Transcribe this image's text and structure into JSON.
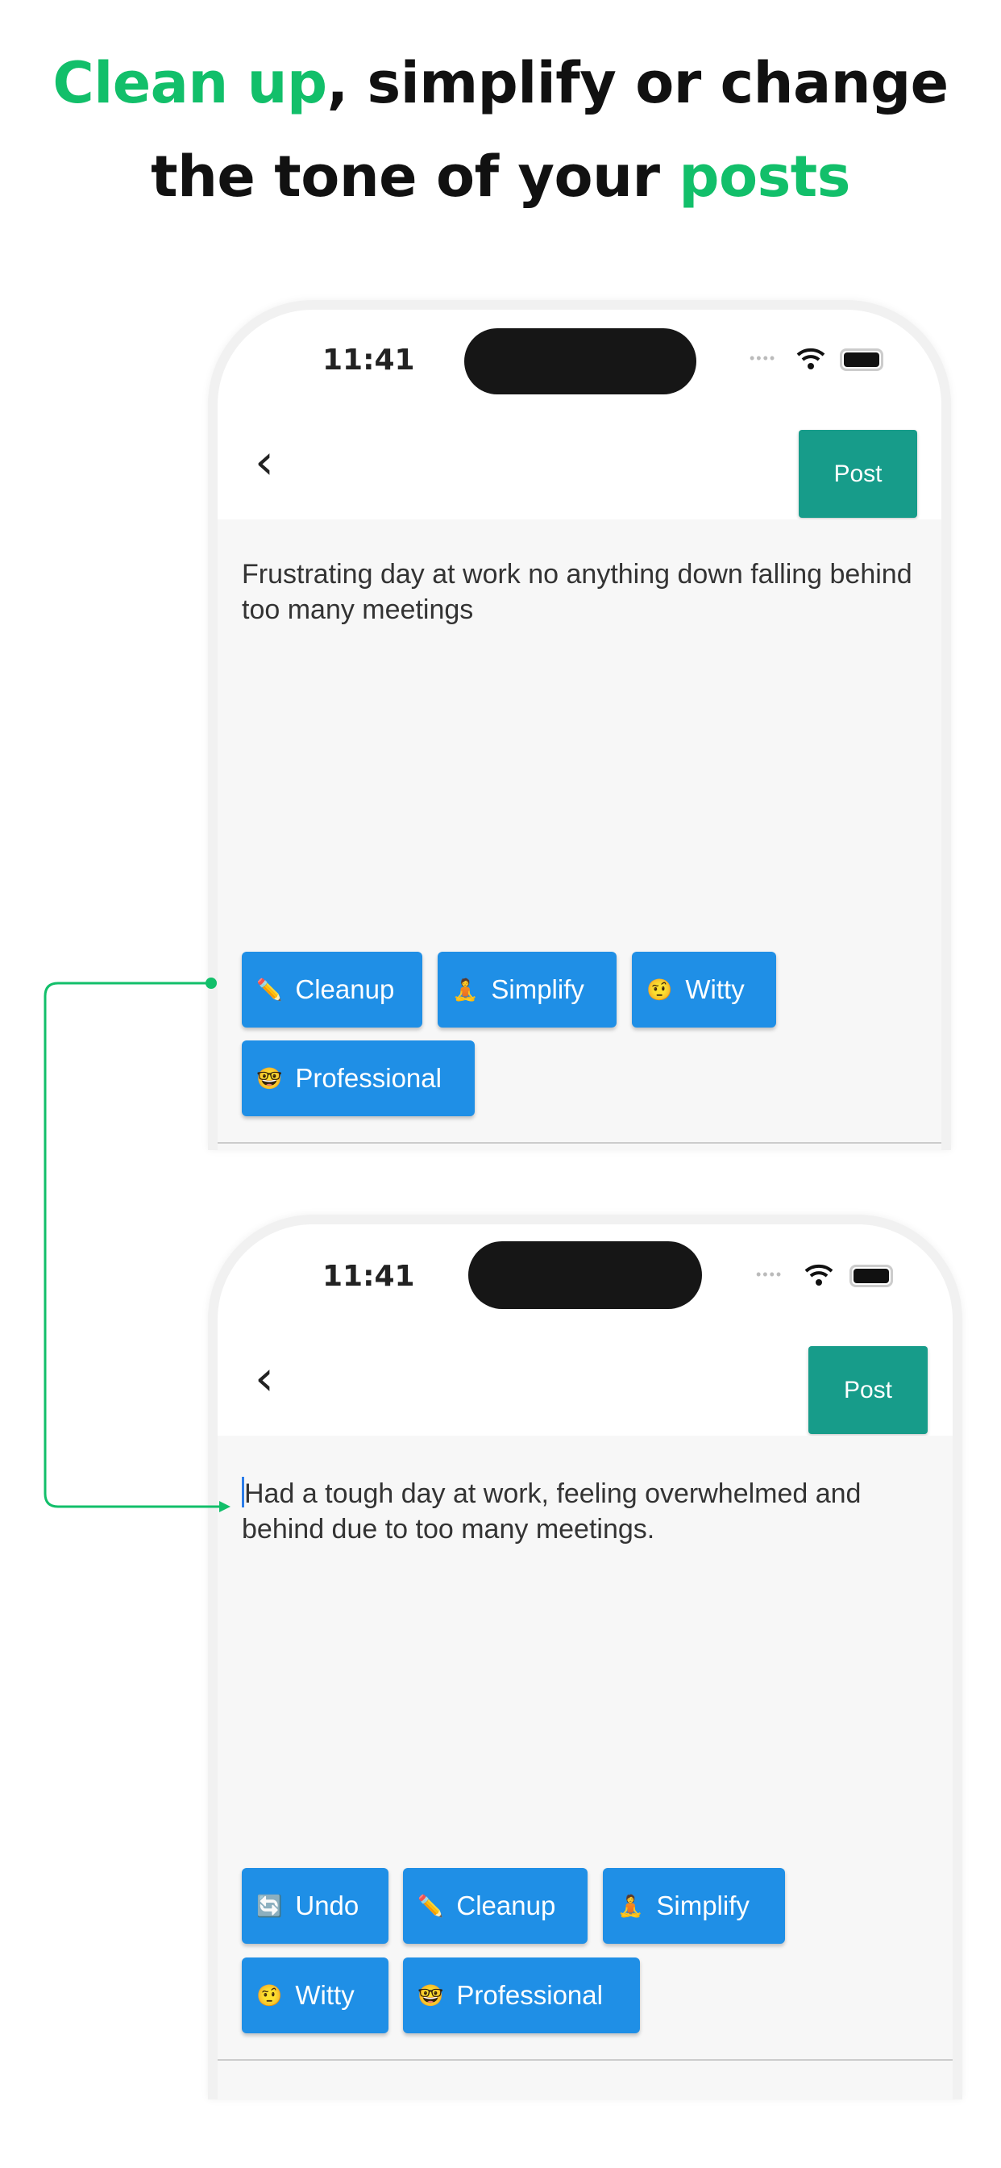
{
  "headline": {
    "line1_highlight": "Clean up",
    "line1_rest": ", simplify or change",
    "line2_rest": "the tone of your ",
    "line2_highlight": "posts"
  },
  "colors": {
    "accent_green": "#12bf6a",
    "post_button": "#179c8a",
    "chip_blue": "#1f8fe6"
  },
  "before": {
    "status_time": "11:41",
    "post_label": "Post",
    "text": "Frustrating day at work no anything down falling behind too many meetings",
    "chips": [
      {
        "emoji": "✏️",
        "label": "Cleanup"
      },
      {
        "emoji": "🧘",
        "label": "Simplify"
      },
      {
        "emoji": "🤨",
        "label": "Witty"
      },
      {
        "emoji": "🤓",
        "label": "Professional"
      }
    ]
  },
  "after": {
    "status_time": "11:41",
    "post_label": "Post",
    "text": "Had a tough day at work, feeling overwhelmed and behind due to too many meetings.",
    "chips": [
      {
        "emoji": "🔄",
        "label": "Undo"
      },
      {
        "emoji": "✏️",
        "label": "Cleanup"
      },
      {
        "emoji": "🧘",
        "label": "Simplify"
      },
      {
        "emoji": "🤨",
        "label": "Witty"
      },
      {
        "emoji": "🤓",
        "label": "Professional"
      }
    ]
  }
}
